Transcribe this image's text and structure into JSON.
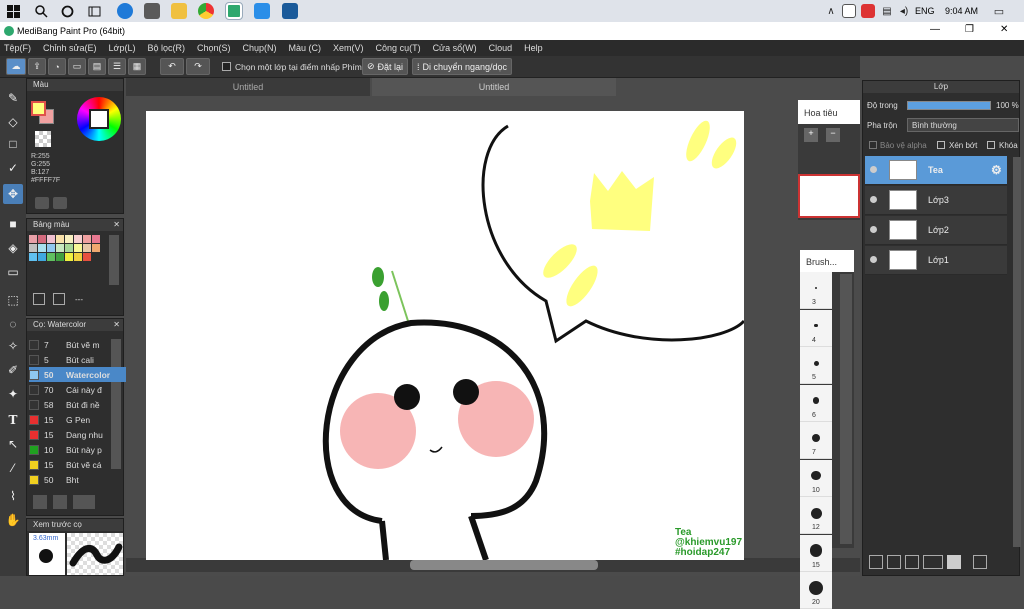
{
  "taskbar": {
    "tray_lang": "ENG",
    "clock": "9:04 AM"
  },
  "window": {
    "title": "MediBang Paint Pro (64bit)",
    "min": "—",
    "max": "❐",
    "close": "✕"
  },
  "menu": [
    "Tệp(F)",
    "Chỉnh sửa(E)",
    "Lớp(L)",
    "Bộ lọc(R)",
    "Chọn(S)",
    "Chụp(N)",
    "Màu (C)",
    "Xem(V)",
    "Công cụ(T)",
    "Cửa sổ(W)",
    "Cloud",
    "Help"
  ],
  "toolbar": {
    "select_layer_label": "Chọn một lớp tại điểm nhấp",
    "shortcut_label": "Phím",
    "reset_label": "Đặt lại",
    "move_label": "Di chuyển ngang/dọc"
  },
  "tabs": [
    "Untitled",
    "Untitled"
  ],
  "color_panel": {
    "title": "Màu",
    "r": "R:255",
    "g": "G:255",
    "b": "B:127",
    "hex": "#FFFF7F"
  },
  "palette_panel": {
    "title": "Bảng màu",
    "dash": "---",
    "swatches": [
      "#e8a0a8",
      "#d46a7e",
      "#f0c0d0",
      "#f8e0a8",
      "#f8f0c0",
      "#f8d0d0",
      "#f0a0a0",
      "#e87890",
      "#c0c0c0",
      "#a8e0f0",
      "#90c8f0",
      "#c8e8c0",
      "#a8d898",
      "#f8f898",
      "#e8c8a8",
      "#f0a870",
      "#60c0f0",
      "#40a8e0",
      "#60c060",
      "#40a040",
      "#f0f040",
      "#f0d040",
      "#e85040"
    ]
  },
  "brush_panel": {
    "title": "Cọ: Watercolor",
    "brushes": [
      {
        "num": "7",
        "name": "Bút vẽ m",
        "color": "#333333"
      },
      {
        "num": "5",
        "name": "Bút cali",
        "color": "#333333"
      },
      {
        "num": "50",
        "name": "Watercolor",
        "color": "#8ec8f0",
        "selected": true
      },
      {
        "num": "70",
        "name": "Cái này đ",
        "color": "#333333"
      },
      {
        "num": "58",
        "name": "Bút đi nề",
        "color": "#333333"
      },
      {
        "num": "15",
        "name": "G Pen",
        "color": "#e83030"
      },
      {
        "num": "15",
        "name": "Dang nhu",
        "color": "#e83030"
      },
      {
        "num": "10",
        "name": "Bút này p",
        "color": "#20a020"
      },
      {
        "num": "15",
        "name": "Bút vẽ cá",
        "color": "#f0d020"
      },
      {
        "num": "50",
        "name": "Bht",
        "color": "#f0d020"
      }
    ]
  },
  "preview_panel": {
    "title": "Xem trước cọ",
    "size": "3.63mm"
  },
  "navigator": {
    "title": "Hoa tiêu"
  },
  "brush_size": {
    "title": "Brush...",
    "sizes": [
      "3",
      "4",
      "5",
      "6",
      "7",
      "10",
      "12",
      "15",
      "20"
    ]
  },
  "layer_panel": {
    "title": "Lớp",
    "opacity_label": "Độ trong",
    "opacity_value": "100 %",
    "blend_label": "Pha trộn",
    "blend_value": "Bình thường",
    "protect_alpha": "Bảo vệ alpha",
    "clip": "Xén bớt",
    "lock": "Khóa",
    "layers": [
      {
        "name": "Tea",
        "selected": true
      },
      {
        "name": "Lớp3",
        "selected": false
      },
      {
        "name": "Lớp2",
        "selected": false
      },
      {
        "name": "Lớp1",
        "selected": false
      }
    ]
  },
  "canvas_text": {
    "line1": "Tea",
    "line2": "@khiemvu197",
    "line3": "#hoidap247"
  }
}
